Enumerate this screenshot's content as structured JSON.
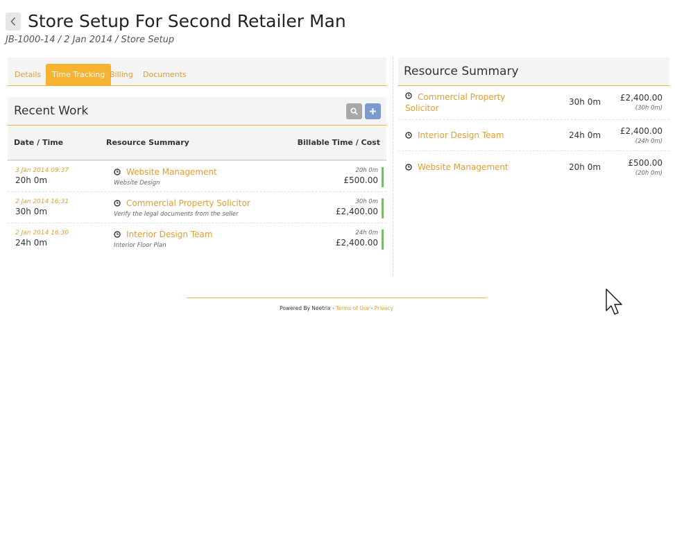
{
  "header": {
    "title": "Store Setup For Second Retailer Man",
    "breadcrumb": "JB-1000-14 / 2 Jan 2014 / Store Setup"
  },
  "tabs": [
    {
      "label": "Details"
    },
    {
      "label": "Time Tracking",
      "active": true
    },
    {
      "label": "Billing"
    },
    {
      "label": "Documents"
    }
  ],
  "recent_work": {
    "title": "Recent Work",
    "columns": {
      "date": "Date / Time",
      "resource": "Resource Summary",
      "billable": "Billable Time / Cost"
    },
    "rows": [
      {
        "date": "3 Jan 2014 09:37",
        "duration": "20h 0m",
        "name": "Website Management",
        "desc": "Website Design",
        "time": "20h 0m",
        "cost": "£500.00"
      },
      {
        "date": "2 Jan 2014 16:31",
        "duration": "30h 0m",
        "name": "Commercial Property Solicitor",
        "desc": "Verify the legal documents from the seller",
        "time": "30h 0m",
        "cost": "£2,400.00"
      },
      {
        "date": "2 Jan 2014 16:30",
        "duration": "24h 0m",
        "name": "Interior Design Team",
        "desc": "Interior Floor Plan",
        "time": "24h 0m",
        "cost": "£2,400.00"
      }
    ]
  },
  "resource_summary": {
    "title": "Resource Summary",
    "rows": [
      {
        "name": "Commercial Property Solicitor",
        "duration": "30h 0m",
        "cost": "£2,400.00",
        "sub": "(30h 0m)"
      },
      {
        "name": "Interior Design Team",
        "duration": "24h 0m",
        "cost": "£2,400.00",
        "sub": "(24h 0m)"
      },
      {
        "name": "Website Management",
        "duration": "20h 0m",
        "cost": "£500.00",
        "sub": "(20h 0m)"
      }
    ]
  },
  "footer": {
    "powered": "Powered By Neetrix - ",
    "terms": "Terms of Use",
    "sep": " - ",
    "privacy": "Privacy"
  },
  "colors": {
    "accent": "#f5b331",
    "link": "#e39c2e",
    "bar": "#7cba6b",
    "search_btn": "#a8a8a8",
    "add_btn": "#7c9bcc"
  },
  "icons": {
    "back": "chevron-left-icon",
    "search": "search-icon",
    "add": "plus-icon",
    "clock": "clock-icon",
    "cursor": "mouse-pointer-icon"
  }
}
